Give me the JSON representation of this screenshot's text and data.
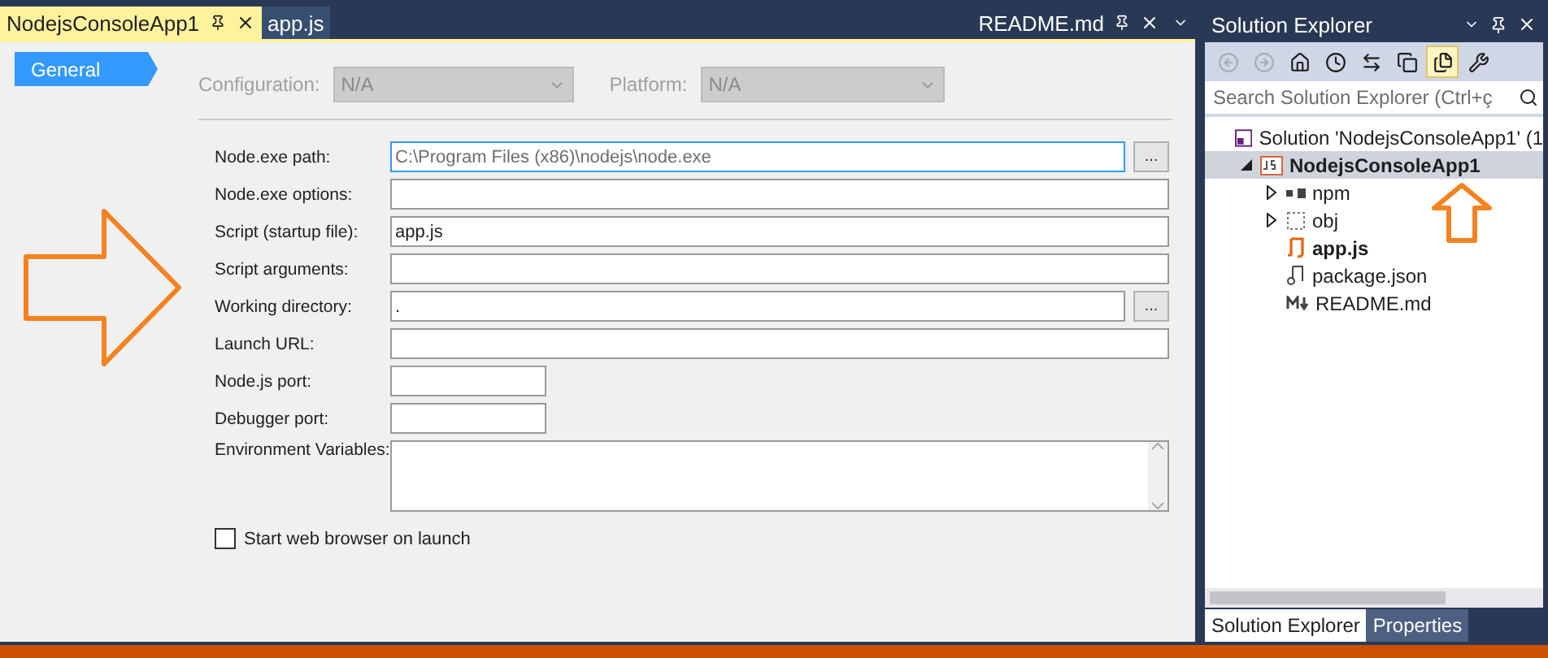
{
  "document_tabs": [
    {
      "label": "NodejsConsoleApp1",
      "selected": true
    },
    {
      "label": "app.js",
      "selected": false
    }
  ],
  "pinned_tabs": [
    {
      "label": "README.md",
      "selected": false
    }
  ],
  "nav": [
    {
      "label": "General",
      "selected": true
    }
  ],
  "configuration": {
    "label": "Configuration:",
    "value": "N/A",
    "disabled": true
  },
  "platform": {
    "label": "Platform:",
    "value": "N/A",
    "disabled": true
  },
  "fields": [
    {
      "label": "Node.exe path:",
      "value": "C:\\Program Files (x86)\\nodejs\\node.exe",
      "kind": "wide",
      "browse": true,
      "focused": true
    },
    {
      "label": "Node.exe options:",
      "kind": "wide",
      "browse": false,
      "focused": false
    },
    {
      "label": "Script (startup file):",
      "value": "app.js",
      "kind": "wide",
      "browse": false,
      "focused": false
    },
    {
      "label": "Script arguments:",
      "kind": "wide",
      "browse": false,
      "focused": false
    },
    {
      "label": "Working directory:",
      "value": ".",
      "kind": "wide",
      "browse": true,
      "focused": false
    },
    {
      "label": "Launch URL:",
      "kind": "wide",
      "browse": false,
      "focused": false
    },
    {
      "label": "Node.js port:",
      "kind": "short",
      "browse": false,
      "focused": false
    },
    {
      "label": "Debugger port:",
      "kind": "short",
      "browse": false,
      "focused": false
    },
    {
      "label": "Environment Variables:",
      "kind": "multiline",
      "browse": false,
      "focused": false
    }
  ],
  "browse_label": "...",
  "start_browser": {
    "label": "Start web browser on launch",
    "checked": false
  },
  "solution_explorer": {
    "title": "Solution Explorer",
    "toolbar": [
      {
        "kind": "back",
        "disabled": true,
        "selected": false
      },
      {
        "kind": "forward",
        "disabled": true,
        "selected": false
      },
      {
        "kind": "home",
        "disabled": false,
        "selected": false
      },
      {
        "kind": "history",
        "disabled": false,
        "selected": false
      },
      {
        "kind": "sync",
        "disabled": false,
        "selected": false
      },
      {
        "kind": "collapse",
        "disabled": false,
        "selected": false
      },
      {
        "kind": "show-all",
        "disabled": false,
        "selected": true
      },
      {
        "kind": "properties",
        "disabled": false,
        "selected": false
      }
    ],
    "search": {
      "placeholder": "Search Solution Explorer (Ctrl+ç"
    },
    "tree": [
      {
        "label": "Solution 'NodejsConsoleApp1' (1",
        "kind": "solution",
        "selected": false,
        "bold": false,
        "children": [
          {
            "label": "NodejsConsoleApp1",
            "kind": "project",
            "selected": true,
            "bold": true,
            "expanded": true,
            "children": [
              {
                "label": "npm",
                "kind": "npm",
                "selected": false,
                "bold": false,
                "expanded": false
              },
              {
                "label": "obj",
                "kind": "folder",
                "selected": false,
                "bold": false,
                "expanded": false
              },
              {
                "label": "app.js",
                "kind": "script",
                "selected": false,
                "bold": true
              },
              {
                "label": "package.json",
                "kind": "json",
                "selected": false,
                "bold": false
              },
              {
                "label": "README.md",
                "kind": "markdown",
                "selected": false,
                "bold": false
              }
            ]
          }
        ]
      }
    ],
    "tabs": [
      {
        "label": "Solution Explorer",
        "selected": true
      },
      {
        "label": "Properties",
        "selected": false
      }
    ]
  }
}
